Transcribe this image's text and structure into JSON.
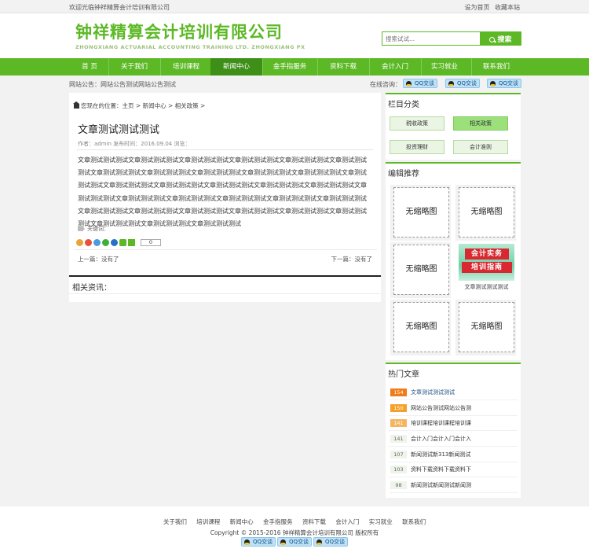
{
  "topbar": {
    "welcome": "欢迎光临钟祥精算会计培训有限公司",
    "set_home": "设为首页",
    "bookmark": "收藏本站"
  },
  "logo": {
    "cn": "钟祥精算会计培训有限公司",
    "en": "ZHONGXIANG ACTUARIAL ACCOUNTING TRAINING LTD. ZHONGXIANG PX"
  },
  "search": {
    "placeholder": "搜索试试...",
    "button": "搜索"
  },
  "nav": [
    "首 页",
    "关于我们",
    "培训课程",
    "新闻中心",
    "金手指服务",
    "资料下载",
    "会计入门",
    "实习就业",
    "联系我们"
  ],
  "notice": {
    "text": "网站公告：网站公告测试网站公告测试",
    "online": "在线咨询："
  },
  "qq_label": "QQ交谈",
  "breadcrumb": {
    "prefix": "您现在的位置：",
    "home": "主页",
    "sep": ">",
    "news": "新闻中心",
    "cat": "相关政策"
  },
  "article": {
    "title": "文章测试测试测试",
    "meta": "作者：admin   发布时间：2016.09.04   浏览：",
    "body": "文章测试测试测试文章测试测试测试文章测试测试测试文章测试测试测试文章测试测试测试文章测试测试测试文章测试测试测试文章测试测试测试文章测试测试测试文章测试测试测试文章测试测试测试文章测试测试测试文章测试测试测试文章测试测试测试文章测试测试测试文章测试测试测试文章测试测试测试文章测试测试测试文章测试测试测试文章测试测试测试文章测试测试测试文章测试测试测试文章测试测试测试文章测试测试测试文章测试测试测试文章测试测试测试文章测试测试测试文章测试测试测试文章测试测试测试文章测试测试测试文章测试测试测试文章测试测试测试",
    "keywords": "关键词：",
    "share_count": "0",
    "prev": "上一篇：没有了",
    "next": "下一篇：没有了"
  },
  "related": {
    "title": "相关资讯："
  },
  "sidebar": {
    "cat_title": "栏目分类",
    "cats": [
      "税收政策",
      "相关政策",
      "投资理财",
      "会计准则"
    ],
    "rec_title": "编辑推荐",
    "no_thumb": "无缩略图",
    "ad": {
      "line1": "会计实务",
      "line2": "培训指南",
      "caption": "文章测试测试测试"
    },
    "hot_title": "热门文章",
    "hot": [
      {
        "num": "154",
        "text": "文章测试测试测试"
      },
      {
        "num": "150",
        "text": "网站公告测试网站公告测"
      },
      {
        "num": "141",
        "text": "培训课程培训课程培训课"
      },
      {
        "num": "141",
        "text": "会计入门会计入门会计入"
      },
      {
        "num": "107",
        "text": "新闻测试新313新闻测试"
      },
      {
        "num": "103",
        "text": "资料下载资料下载资料下"
      },
      {
        "num": "98",
        "text": "新闻测试新闻测试新闻测"
      }
    ]
  },
  "footer": {
    "nav": [
      "关于我们",
      "培训课程",
      "新闻中心",
      "金手指服务",
      "资料下载",
      "会计入门",
      "实习就业",
      "联系我们"
    ],
    "copyright": "Copyright © 2015-2016 钟祥精算会计培训有限公司 版权所有"
  },
  "colors": {
    "brand": "#5cb825",
    "nav_active": "#3d8f17",
    "hot1": "#f07b18",
    "hot2": "#f4a02a",
    "hot3": "#f6b560"
  }
}
